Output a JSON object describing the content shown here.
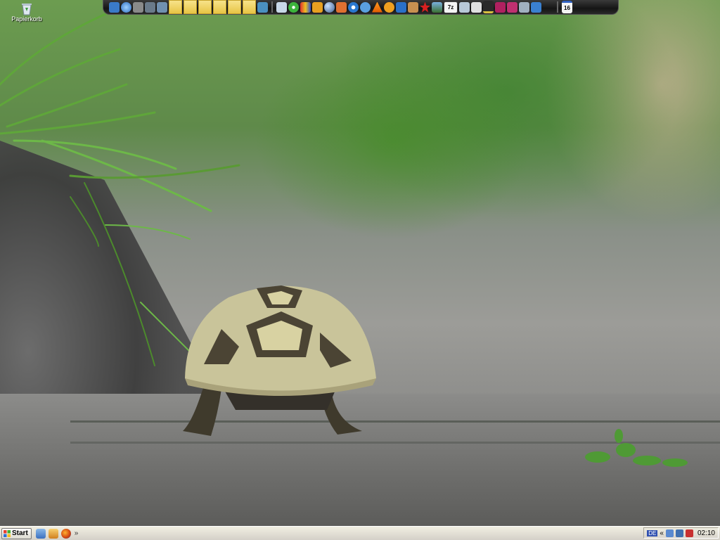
{
  "desktop": {
    "icons": [
      {
        "label": "Papierkorb",
        "icon": "recycle-bin-icon"
      }
    ]
  },
  "dock": {
    "groups": [
      {
        "name": "left-tools",
        "icons": [
          "media-icon",
          "globe-icon",
          "tool-icon",
          "disk-icon",
          "archive-icon"
        ]
      },
      {
        "name": "drop-slots",
        "count": 6
      },
      {
        "name": "apps",
        "icons": [
          "network-icon",
          "notepad-icon",
          "flower-icon",
          "chat-icon",
          "folder-icon",
          "sphere-icon",
          "wand-icon",
          "media-player-icon",
          "refresh-icon",
          "vlc-icon",
          "avatar-icon",
          "folder-blue-icon",
          "paint-icon",
          "star-icon",
          "image-icon",
          "sevenzip-icon",
          "monitor-icon",
          "calendar-icon",
          "hat-icon",
          "rar-icon",
          "rar2-icon",
          "box-icon",
          "flag-icon"
        ]
      },
      {
        "name": "right",
        "icons": [
          "calendar-day-icon"
        ]
      }
    ],
    "sevenzip_label": "7z",
    "calendar_day": "16"
  },
  "taskbar": {
    "start_label": "Start",
    "quicklaunch": [
      "desktop-icon",
      "explorer-icon",
      "firefox-icon"
    ],
    "overflow": "»",
    "tray": {
      "lang": "DE",
      "expand": "«",
      "clock": "02:10"
    }
  },
  "colors": {
    "taskbar": "#d4d0c8",
    "dock": "#151515",
    "slot": "#e8c445"
  }
}
